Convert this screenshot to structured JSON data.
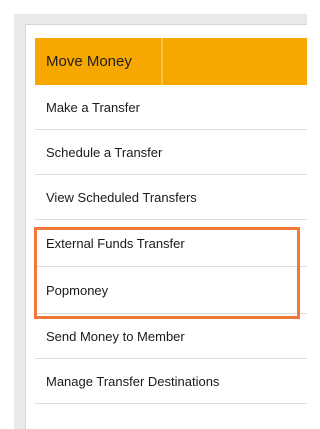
{
  "colors": {
    "header_bg": "#f7a800",
    "header_text": "#1f1f1f",
    "highlight_border": "#f0783a",
    "divider": "#dcdcdc",
    "frame": "#e9e9e9"
  },
  "nav": {
    "header": "Move Money",
    "items": [
      {
        "label": "Make a Transfer"
      },
      {
        "label": "Schedule a Transfer"
      },
      {
        "label": "View Scheduled Transfers"
      },
      {
        "label": "External Funds Transfer"
      },
      {
        "label": "Popmoney"
      },
      {
        "label": "Send Money to Member"
      },
      {
        "label": "Manage Transfer Destinations"
      }
    ]
  }
}
